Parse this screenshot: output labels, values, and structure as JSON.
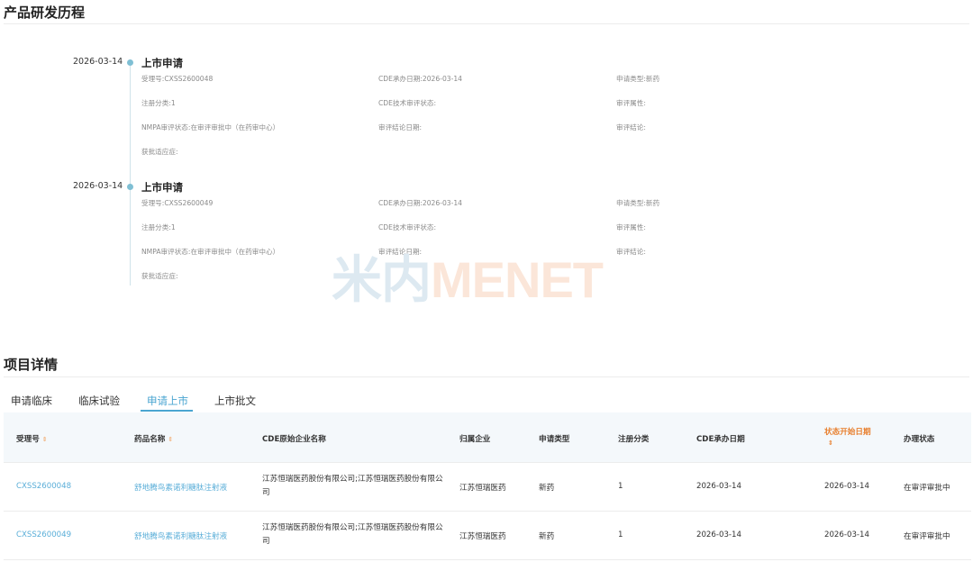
{
  "dev_history": {
    "title": "产品研发历程",
    "entries": [
      {
        "date": "2026-03-14",
        "title": "上市申请",
        "acceptance_no": "受理号:CXSS2600048",
        "cde_date": "CDE承办日期:2026-03-14",
        "app_type": "申请类型:新药",
        "reg_class": "注册分类:1",
        "cde_tech_status": "CDE技术审评状态:",
        "review_attr": "审评属性:",
        "nmpa_status": "NMPA审评状态:在审评审批中（在药审中心）",
        "review_end_date": "审评结论日期:",
        "review_conclusion": "审评结论:",
        "indication": "获批适应症:"
      },
      {
        "date": "2026-03-14",
        "title": "上市申请",
        "acceptance_no": "受理号:CXSS2600049",
        "cde_date": "CDE承办日期:2026-03-14",
        "app_type": "申请类型:新药",
        "reg_class": "注册分类:1",
        "cde_tech_status": "CDE技术审评状态:",
        "review_attr": "审评属性:",
        "nmpa_status": "NMPA审评状态:在审评审批中（在药审中心）",
        "review_end_date": "审评结论日期:",
        "review_conclusion": "审评结论:",
        "indication": "获批适应症:"
      }
    ]
  },
  "watermark": {
    "cn": "米内",
    "en": "MENET"
  },
  "project_detail": {
    "title": "项目详情",
    "tabs": [
      "申请临床",
      "临床试验",
      "申请上市",
      "上市批文"
    ],
    "active_tab": "申请上市",
    "columns": [
      "受理号",
      "药品名称",
      "CDE原始企业名称",
      "归属企业",
      "申请类型",
      "注册分类",
      "CDE承办日期",
      "状态开始日期",
      "办理状态"
    ],
    "rows": [
      {
        "acceptance_no": "CXSS2600048",
        "drug_name": "舒地腾鸟素诺利糖肽注射液",
        "cde_company": "江苏恒瑞医药股份有限公司;江苏恒瑞医药股份有限公司",
        "owner": "江苏恒瑞医药",
        "app_type": "新药",
        "reg_class": "1",
        "cde_date": "2026-03-14",
        "status_start": "2026-03-14",
        "status": "在审评审批中"
      },
      {
        "acceptance_no": "CXSS2600049",
        "drug_name": "舒地腾鸟素诺利糖肽注射液",
        "cde_company": "江苏恒瑞医药股份有限公司;江苏恒瑞医药股份有限公司",
        "owner": "江苏恒瑞医药",
        "app_type": "新药",
        "reg_class": "1",
        "cde_date": "2026-03-14",
        "status_start": "2026-03-14",
        "status": "在审评审批中"
      }
    ]
  },
  "colors": {
    "accent": "#4aa5d1",
    "sort_active": "#e87f2e",
    "timeline_dot": "#7fbfd4"
  }
}
